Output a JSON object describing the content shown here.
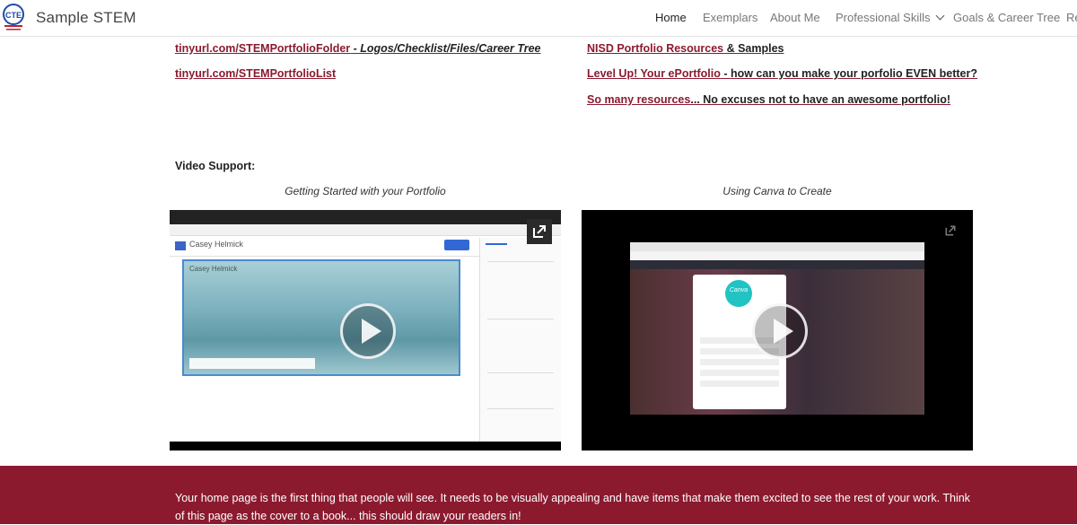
{
  "header": {
    "site_title": "Sample STEM",
    "nav": [
      "Home",
      "Exemplars",
      "About Me",
      "Professional Skills",
      "Goals & Career Tree",
      "Re"
    ]
  },
  "links_left": [
    {
      "label": "tinyurl.com/STEMPortfolioFolder",
      "desc": " - Logos/Checklist/Files/Career Tree"
    },
    {
      "label": "tinyurl.com/STEMPortfolioList",
      "desc": ""
    }
  ],
  "links_right": [
    {
      "label": "NISD Portfolio Resources",
      "desc": " & Samples"
    },
    {
      "label": "Level Up! Your ePortfolio",
      "desc": " - how can you make your porfolio EVEN better?"
    },
    {
      "label": "So many resources",
      "desc": "...  No excuses not to have an awesome portfolio!"
    }
  ],
  "video_section": {
    "heading": "Video Support:",
    "videos": [
      {
        "caption": "Getting Started with your Portfolio",
        "title_in_video": "Casey Helmick"
      },
      {
        "caption": "Using Canva to Create",
        "title_in_video": "Canva"
      }
    ]
  },
  "banner": {
    "text": "Your home page is the first thing that people will see. It needs to be visually appealing and have items that make them excited to see the rest of your work. Think of this page as the cover to a book... this should draw your readers in!"
  },
  "colors": {
    "accent": "#8b1a2f",
    "banner": "#8b1a2f"
  }
}
